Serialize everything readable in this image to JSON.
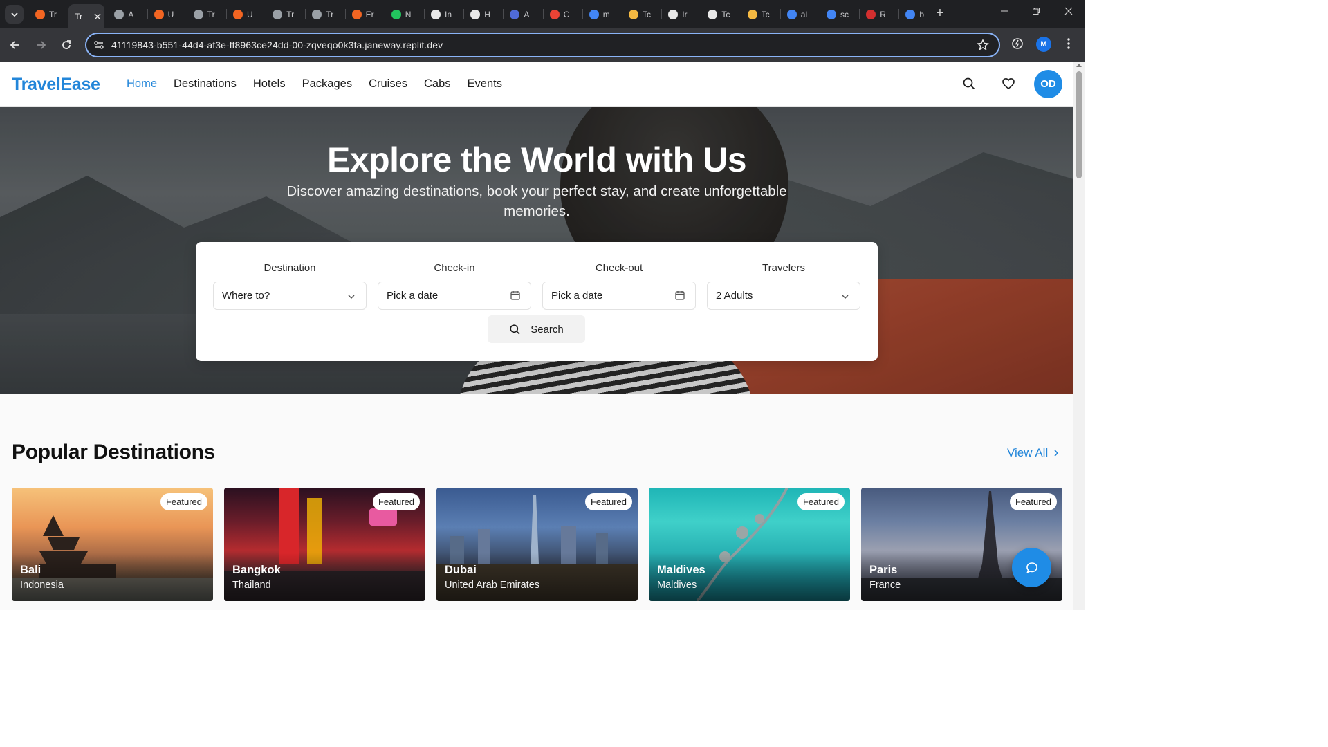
{
  "browser": {
    "tabs": [
      {
        "label": "Tr",
        "color": "#f26522"
      },
      {
        "label": "Tr",
        "color": "#35363a",
        "active": true
      },
      {
        "label": "A",
        "color": "#9aa0a6"
      },
      {
        "label": "U",
        "color": "#f26522"
      },
      {
        "label": "Tr",
        "color": "#9aa0a6"
      },
      {
        "label": "U",
        "color": "#f26522"
      },
      {
        "label": "Tr",
        "color": "#9aa0a6"
      },
      {
        "label": "Tr",
        "color": "#9aa0a6"
      },
      {
        "label": "Er",
        "color": "#f26522"
      },
      {
        "label": "N",
        "color": "#22c55e"
      },
      {
        "label": "In",
        "color": "#e8e8e8"
      },
      {
        "label": "H",
        "color": "#e8e8e8"
      },
      {
        "label": "A",
        "color": "#4f6bd9"
      },
      {
        "label": "C",
        "color": "#ea4335"
      },
      {
        "label": "m",
        "color": "#4285f4"
      },
      {
        "label": "Tc",
        "color": "#f5b942"
      },
      {
        "label": "Ir",
        "color": "#e8e8e8"
      },
      {
        "label": "Tc",
        "color": "#e8e8e8"
      },
      {
        "label": "Tc",
        "color": "#f5b942"
      },
      {
        "label": "al",
        "color": "#4285f4"
      },
      {
        "label": "sc",
        "color": "#4285f4"
      },
      {
        "label": "R",
        "color": "#d32f2f"
      },
      {
        "label": "b",
        "color": "#4285f4"
      }
    ],
    "url": "41119843-b551-44d4-af3e-ff8963ce24dd-00-zqveqo0k3fa.janeway.replit.dev",
    "profile_initial": "M"
  },
  "header": {
    "logo": "TravelEase",
    "nav": [
      "Home",
      "Destinations",
      "Hotels",
      "Packages",
      "Cruises",
      "Cabs",
      "Events"
    ],
    "active_nav": "Home",
    "avatar": "OD"
  },
  "hero": {
    "title": "Explore the World with Us",
    "subtitle": "Discover amazing destinations, book your perfect stay, and create unforgettable memories."
  },
  "search": {
    "destination": {
      "label": "Destination",
      "value": "Where to?"
    },
    "checkin": {
      "label": "Check-in",
      "value": "Pick a date"
    },
    "checkout": {
      "label": "Check-out",
      "value": "Pick a date"
    },
    "travelers": {
      "label": "Travelers",
      "value": "2 Adults"
    },
    "button": "Search"
  },
  "popular": {
    "title": "Popular Destinations",
    "view_all": "View All",
    "badge": "Featured",
    "cards": [
      {
        "city": "Bali",
        "country": "Indonesia"
      },
      {
        "city": "Bangkok",
        "country": "Thailand"
      },
      {
        "city": "Dubai",
        "country": "United Arab Emirates"
      },
      {
        "city": "Maldives",
        "country": "Maldives"
      },
      {
        "city": "Paris",
        "country": "France"
      }
    ]
  },
  "colors": {
    "brand": "#2386d9",
    "accent": "#1f8ce6"
  }
}
